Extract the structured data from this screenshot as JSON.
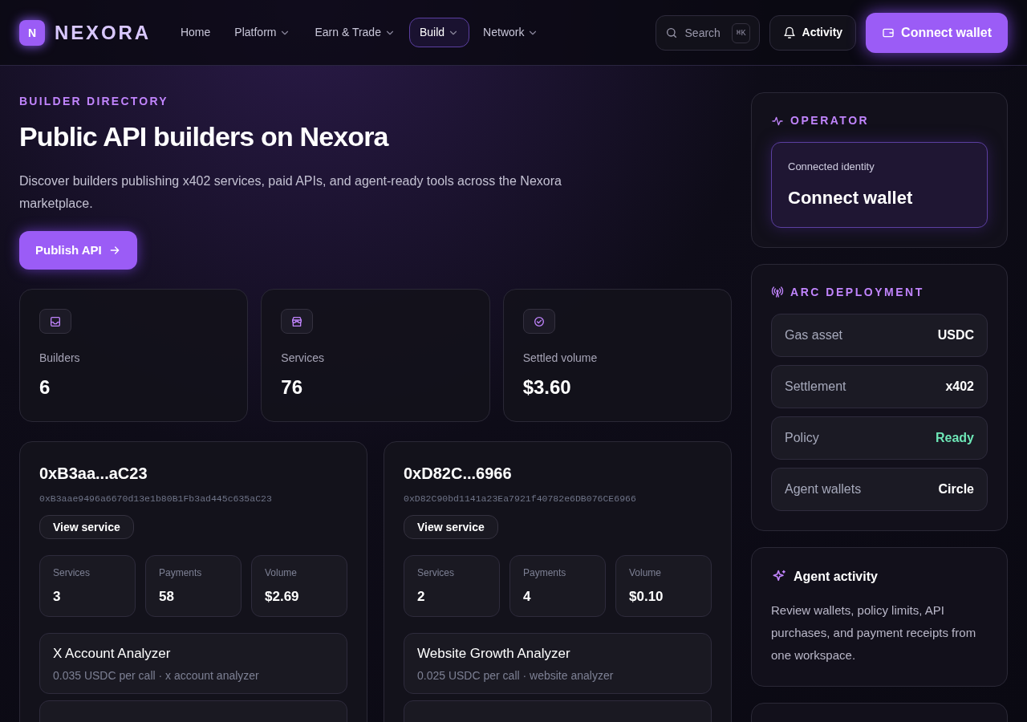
{
  "header": {
    "logo_letter": "N",
    "brand": "NEXORA",
    "nav": [
      {
        "label": "Home",
        "dropdown": false,
        "selected": false
      },
      {
        "label": "Platform",
        "dropdown": true,
        "selected": false
      },
      {
        "label": "Earn & Trade",
        "dropdown": true,
        "selected": false
      },
      {
        "label": "Build",
        "dropdown": true,
        "selected": true
      },
      {
        "label": "Network",
        "dropdown": true,
        "selected": false
      }
    ],
    "search": {
      "placeholder": "Search",
      "shortcut": "⌘K"
    },
    "activity_button": "Activity",
    "connect_button": "Connect wallet"
  },
  "hero": {
    "eyebrow": "BUILDER DIRECTORY",
    "title": "Public API builders on Nexora",
    "description": "Discover builders publishing x402 services, paid APIs, and agent-ready tools across the Nexora marketplace.",
    "button": "Publish API"
  },
  "stats": [
    {
      "kind": "inbox",
      "label": "Builders",
      "value": "6"
    },
    {
      "kind": "store",
      "label": "Services",
      "value": "76"
    },
    {
      "kind": "check",
      "label": "Settled volume",
      "value": "$3.60"
    }
  ],
  "builders": [
    {
      "short": "0xB3aa...aC23",
      "address": "0xB3aae9496a6670d13e1b80B1Fb3ad445c635aC23",
      "button": "View service",
      "metrics": [
        {
          "label": "Services",
          "value": "3"
        },
        {
          "label": "Payments",
          "value": "58"
        },
        {
          "label": "Volume",
          "value": "$2.69"
        }
      ],
      "services": [
        {
          "name": "X Account Analyzer",
          "detail": "0.035 USDC per call · x account analyzer"
        }
      ]
    },
    {
      "short": "0xD82C...6966",
      "address": "0xD82C90bd1141a23Ea7921f40782e6DB076CE6966",
      "button": "View service",
      "metrics": [
        {
          "label": "Services",
          "value": "2"
        },
        {
          "label": "Payments",
          "value": "4"
        },
        {
          "label": "Volume",
          "value": "$0.10"
        }
      ],
      "services": [
        {
          "name": "Website Growth Analyzer",
          "detail": "0.025 USDC per call · website analyzer"
        }
      ]
    }
  ],
  "operator": {
    "title": "OPERATOR",
    "identity_label": "Connected identity",
    "identity_value": "Connect wallet"
  },
  "deployment": {
    "title": "ARC DEPLOYMENT",
    "rows": [
      {
        "label": "Gas asset",
        "value": "USDC",
        "kind": "plain"
      },
      {
        "label": "Settlement",
        "value": "x402",
        "kind": "plain"
      },
      {
        "label": "Policy",
        "value": "Ready",
        "kind": "status"
      },
      {
        "label": "Agent wallets",
        "value": "Circle",
        "kind": "plain"
      }
    ]
  },
  "agent_activity": {
    "title": "Agent activity",
    "description": "Review wallets, policy limits, API purchases, and payment receipts from one workspace."
  }
}
